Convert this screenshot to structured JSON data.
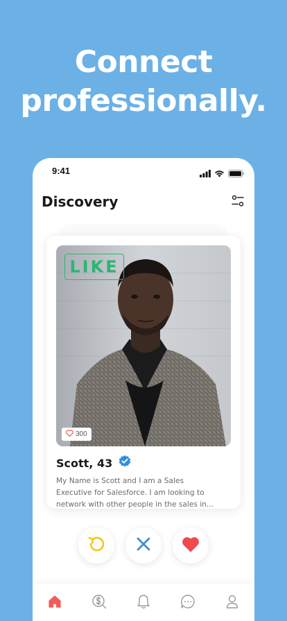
{
  "headline": {
    "line1": "Connect",
    "line2": "professionally."
  },
  "status_bar": {
    "time": "9:41",
    "icons": [
      "signal-icon",
      "wifi-icon",
      "battery-icon"
    ]
  },
  "header": {
    "title": "Discovery",
    "filter_icon": "filter-sliders-icon"
  },
  "profile_card": {
    "stamp": "LIKE",
    "likes_count": "300",
    "name": "Scott, 43",
    "verified_icon": "verified-badge-icon",
    "bio_lines": [
      "My Name is Scott and I am a Sales",
      "Executive for Salesforce. I am looking to",
      "network with other people in the sales in..."
    ]
  },
  "actions": {
    "rewind_icon": "rewind-icon",
    "dislike_icon": "close-icon",
    "like_icon": "heart-icon"
  },
  "tabs": [
    {
      "name": "home",
      "icon": "home-icon",
      "active": true
    },
    {
      "name": "earnings",
      "icon": "dollar-search-icon",
      "active": false
    },
    {
      "name": "notifications",
      "icon": "bell-icon",
      "active": false
    },
    {
      "name": "messages",
      "icon": "chat-icon",
      "active": false
    },
    {
      "name": "profile",
      "icon": "user-icon",
      "active": false
    }
  ],
  "colors": {
    "background": "#6cb1e6",
    "like_green": "#2bb673",
    "heart_red": "#f04a4a",
    "rewind_yellow": "#f5c518",
    "close_blue": "#3a8fd6",
    "verified_blue": "#2f8fe0",
    "active_tab": "#f25c5c"
  }
}
